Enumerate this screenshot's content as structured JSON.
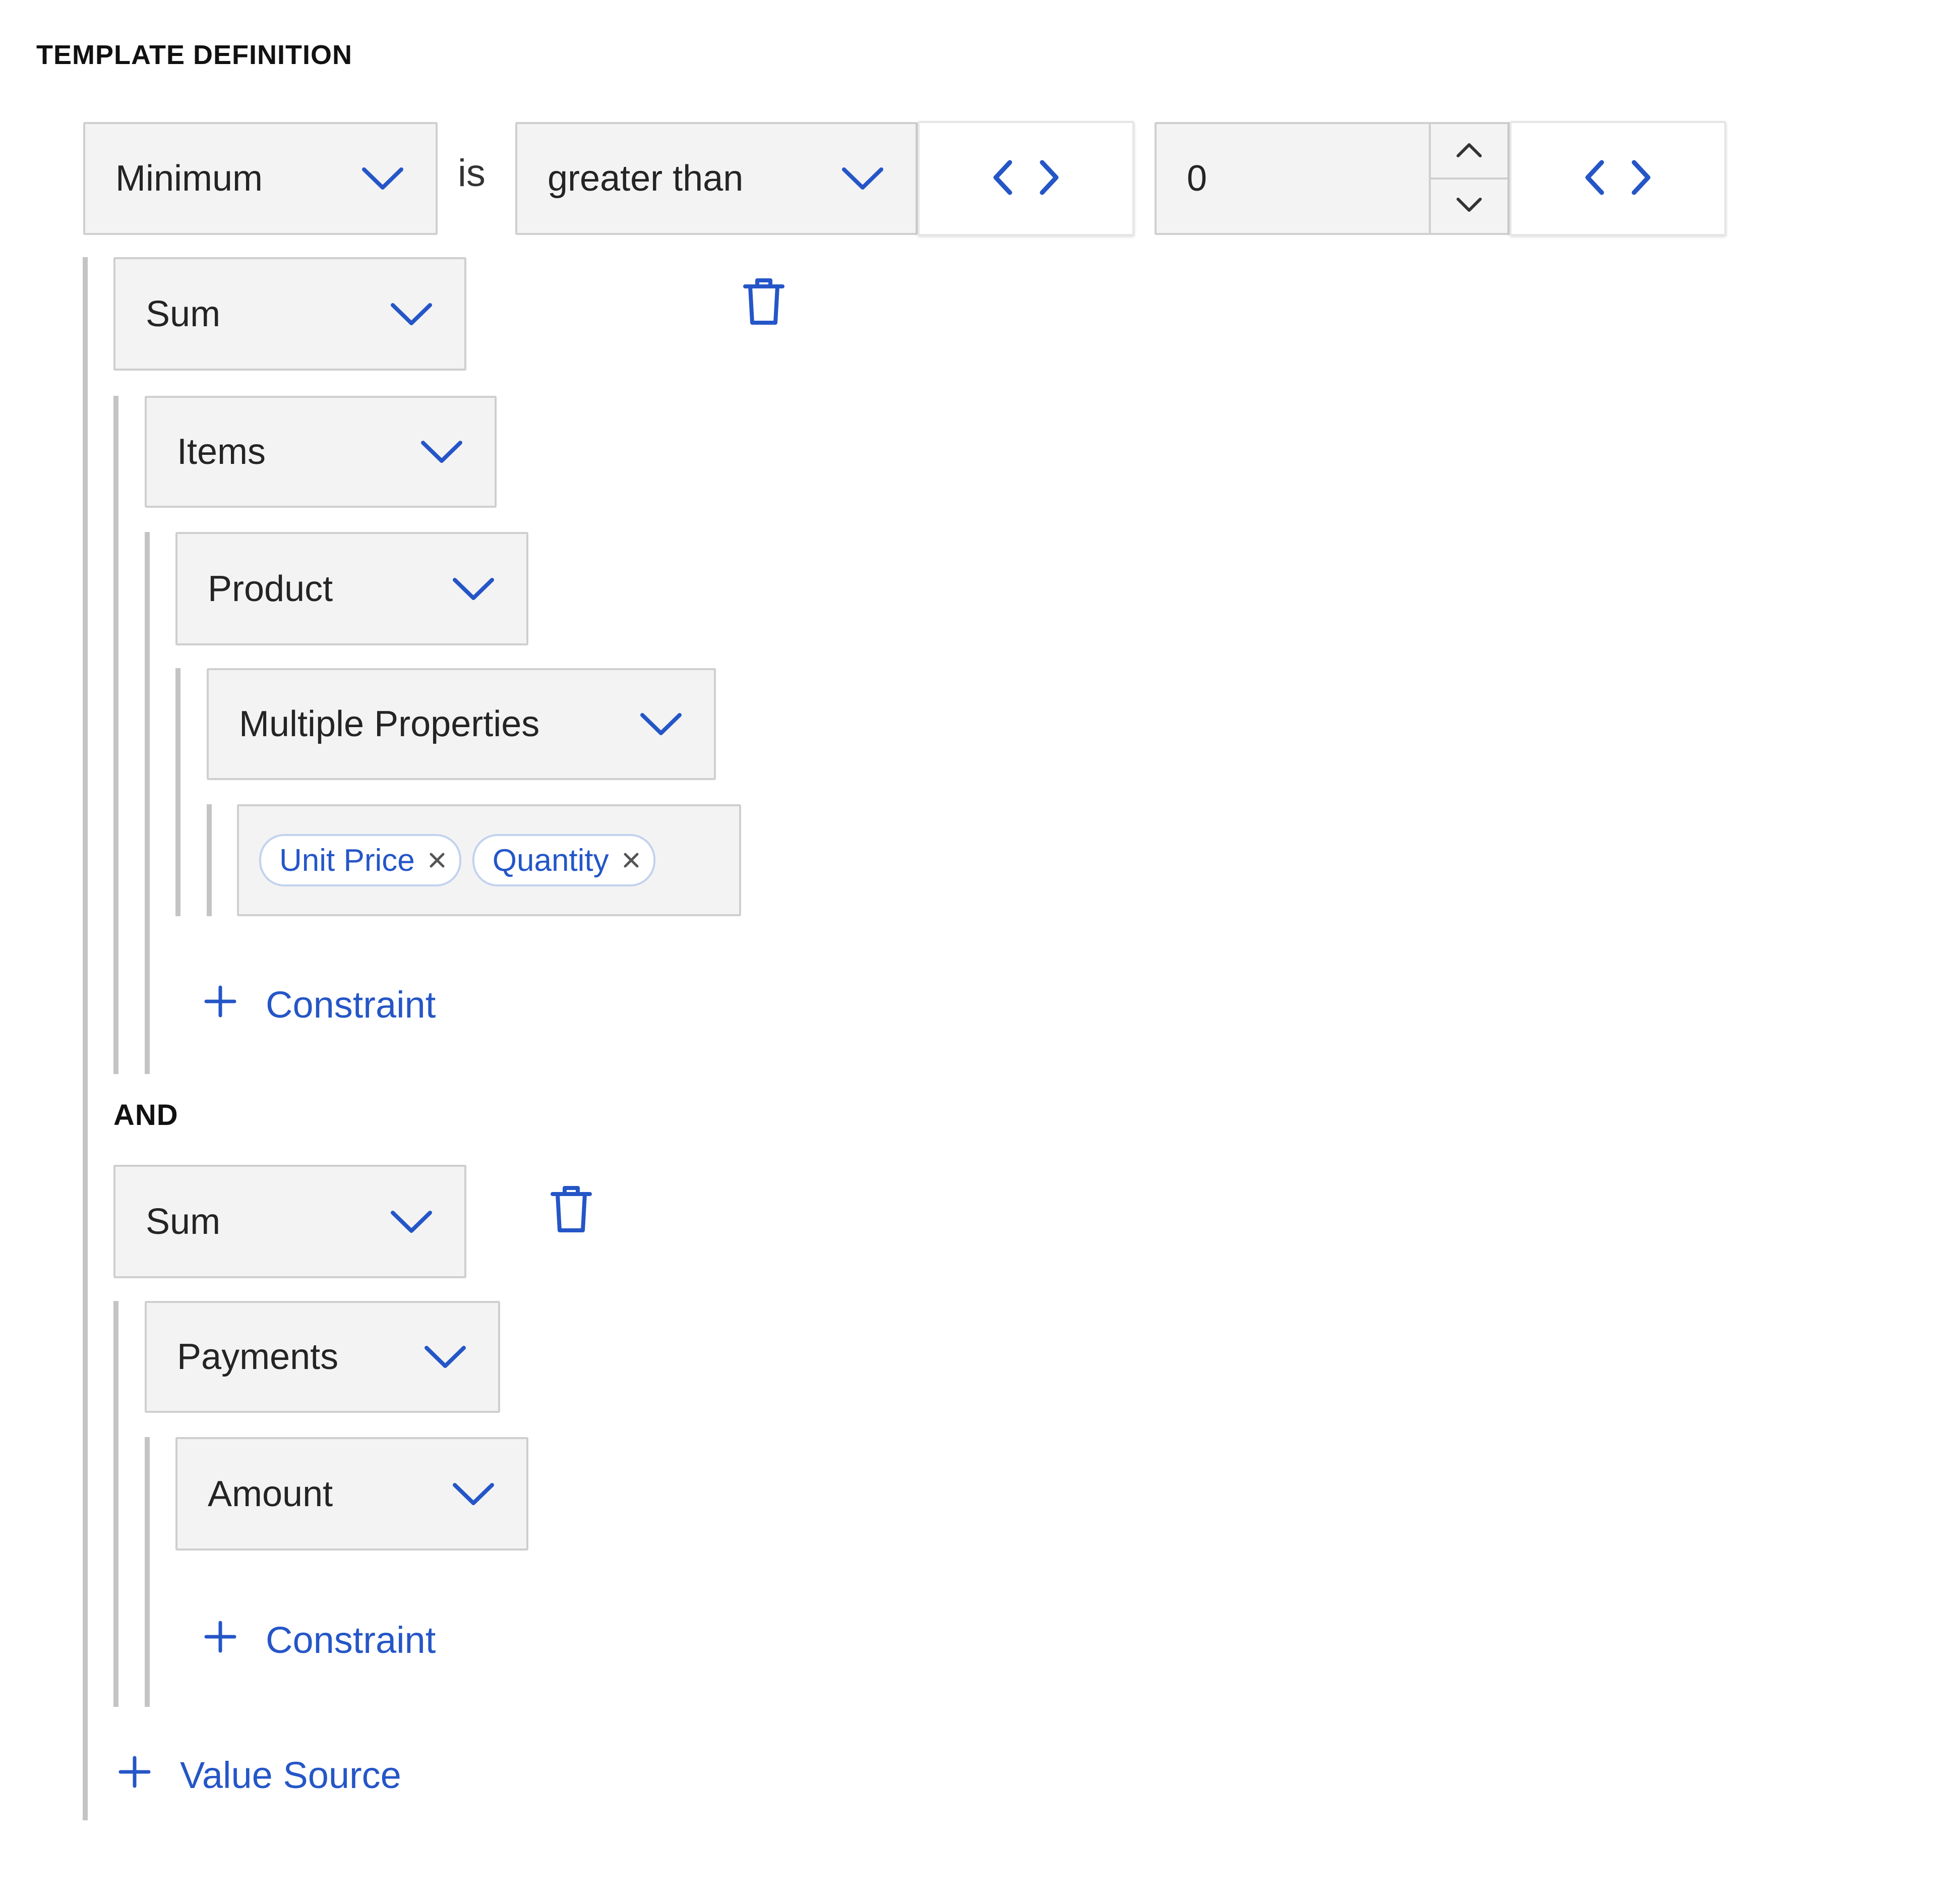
{
  "section_title": "TEMPLATE DEFINITION",
  "condition": {
    "aggregate": "Minimum",
    "is_word": "is",
    "operator": "greater than",
    "value": "0"
  },
  "group1": {
    "function": "Sum",
    "source": "Items",
    "field": "Product",
    "property_mode": "Multiple Properties",
    "tags": [
      "Unit Price",
      "Quantity"
    ],
    "add_constraint": "Constraint"
  },
  "join_label": "AND",
  "group2": {
    "function": "Sum",
    "source": "Payments",
    "field": "Amount",
    "add_constraint": "Constraint"
  },
  "add_value_source": "Value Source",
  "colors": {
    "accent": "#2556c7",
    "border": "#cfcfcf",
    "field_bg": "#f3f3f3",
    "guide": "#c4c4c4"
  },
  "icons": [
    "chevron-down-icon",
    "code-brackets-icon",
    "chevron-up-icon",
    "trash-icon",
    "close-icon",
    "plus-icon"
  ]
}
